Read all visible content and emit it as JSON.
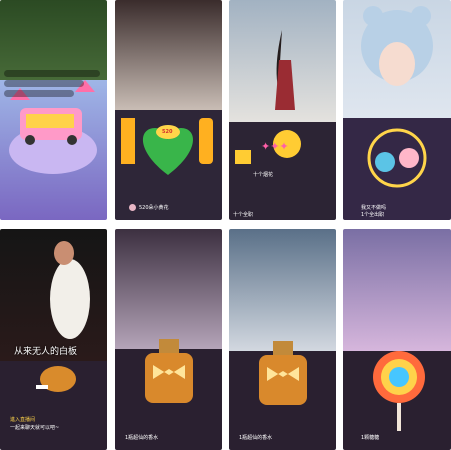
{
  "tiles": [
    {
      "name": "tile-1",
      "gift": "camper-van",
      "colors": {
        "top": "#2f5a2b",
        "panel": "#6b5bb5"
      },
      "lines": [
        "",
        "",
        "",
        "",
        "",
        ""
      ]
    },
    {
      "name": "tile-2",
      "gift": "i-love-u-520",
      "colors": {
        "top": "#4a3a3a",
        "panel": "#3a2a4a"
      },
      "label": "520",
      "lines": [
        "520朵小黄花"
      ]
    },
    {
      "name": "tile-3",
      "gift": "rocket-firework",
      "colors": {
        "top": "#a9b9c9",
        "panel": "#2f2838"
      },
      "lines": [
        "十个烟花",
        "十个全职"
      ]
    },
    {
      "name": "tile-4",
      "gift": "bear-hug",
      "colors": {
        "top": "#c9d4e2",
        "panel": "#3a2c4a"
      },
      "lines": [
        "我又不做吗",
        "1个全出职"
      ]
    },
    {
      "name": "tile-5",
      "gift": "roast-chicken",
      "colors": {
        "top": "#1a1a1a",
        "panel": "#2a2030"
      },
      "caption": "从来无人的白板",
      "lines": [
        "進入直播间",
        "一起来聊天就可以吧~"
      ]
    },
    {
      "name": "tile-6",
      "gift": "perfume",
      "colors": {
        "top": "#5a4a5a",
        "panel": "#2a2030"
      },
      "lines": [
        "1瓶超仙的香水"
      ]
    },
    {
      "name": "tile-7",
      "gift": "perfume",
      "colors": {
        "top": "#6a7d92",
        "panel": "#2a2030"
      },
      "lines": [
        "1瓶超仙的香水"
      ]
    },
    {
      "name": "tile-8",
      "gift": "lollipop",
      "colors": {
        "top": "#6a6f9a",
        "panel": "#2a2030"
      },
      "lines": [
        "1颗糖糖"
      ]
    }
  ]
}
